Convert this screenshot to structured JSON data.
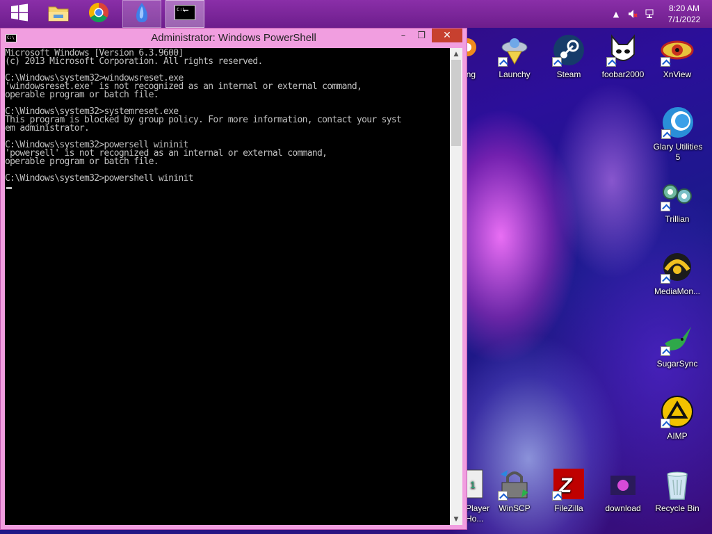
{
  "taskbar": {
    "clock": {
      "time": "8:20 AM",
      "date": "7/1/2022"
    },
    "buttons": [
      {
        "name": "start",
        "icon": "windows-logo-icon"
      },
      {
        "name": "file-explorer",
        "icon": "folder-icon"
      },
      {
        "name": "chrome",
        "icon": "chrome-icon"
      },
      {
        "name": "crystal-app",
        "icon": "blue-crystal-icon"
      },
      {
        "name": "console",
        "icon": "console-icon"
      }
    ],
    "tray": [
      "show-hidden-icons",
      "speaker-muted-icon",
      "network-icon"
    ]
  },
  "window": {
    "title": "Administrator: Windows PowerShell",
    "buttons": {
      "minimize": "–",
      "maximize": "❐",
      "close": "✕"
    },
    "console_lines": [
      "Microsoft Windows [Version 6.3.9600]",
      "(c) 2013 Microsoft Corporation. All rights reserved.",
      "",
      "C:\\Windows\\system32>windowsreset.exe",
      "'windowsreset.exe' is not recognized as an internal or external command,",
      "operable program or batch file.",
      "",
      "C:\\Windows\\system32>systemreset.exe",
      "This program is blocked by group policy. For more information, contact your syst",
      "em administrator.",
      "",
      "C:\\Windows\\system32>powersell wininit",
      "'powersell' is not recognized as an internal or external command,",
      "operable program or batch file.",
      "",
      "C:\\Windows\\system32>powershell wininit"
    ]
  },
  "desktop": {
    "icons": [
      {
        "id": "partial-top",
        "label": "ing"
      },
      {
        "id": "launchy",
        "label": "Launchy"
      },
      {
        "id": "steam",
        "label": "Steam"
      },
      {
        "id": "foobar2000",
        "label": "foobar2000"
      },
      {
        "id": "xnview",
        "label": "XnView"
      },
      {
        "id": "glary",
        "label": "Glary Utilities 5"
      },
      {
        "id": "trillian",
        "label": "Trillian"
      },
      {
        "id": "mediamonkey",
        "label": "MediaMon..."
      },
      {
        "id": "sugarsync",
        "label": "SugarSync"
      },
      {
        "id": "aimp",
        "label": "AIMP"
      },
      {
        "id": "partial-player",
        "label": "Player Ho..."
      },
      {
        "id": "winscp",
        "label": "WinSCP"
      },
      {
        "id": "filezilla",
        "label": "FileZilla"
      },
      {
        "id": "download",
        "label": "download"
      },
      {
        "id": "recycle-bin",
        "label": "Recycle Bin"
      }
    ]
  }
}
